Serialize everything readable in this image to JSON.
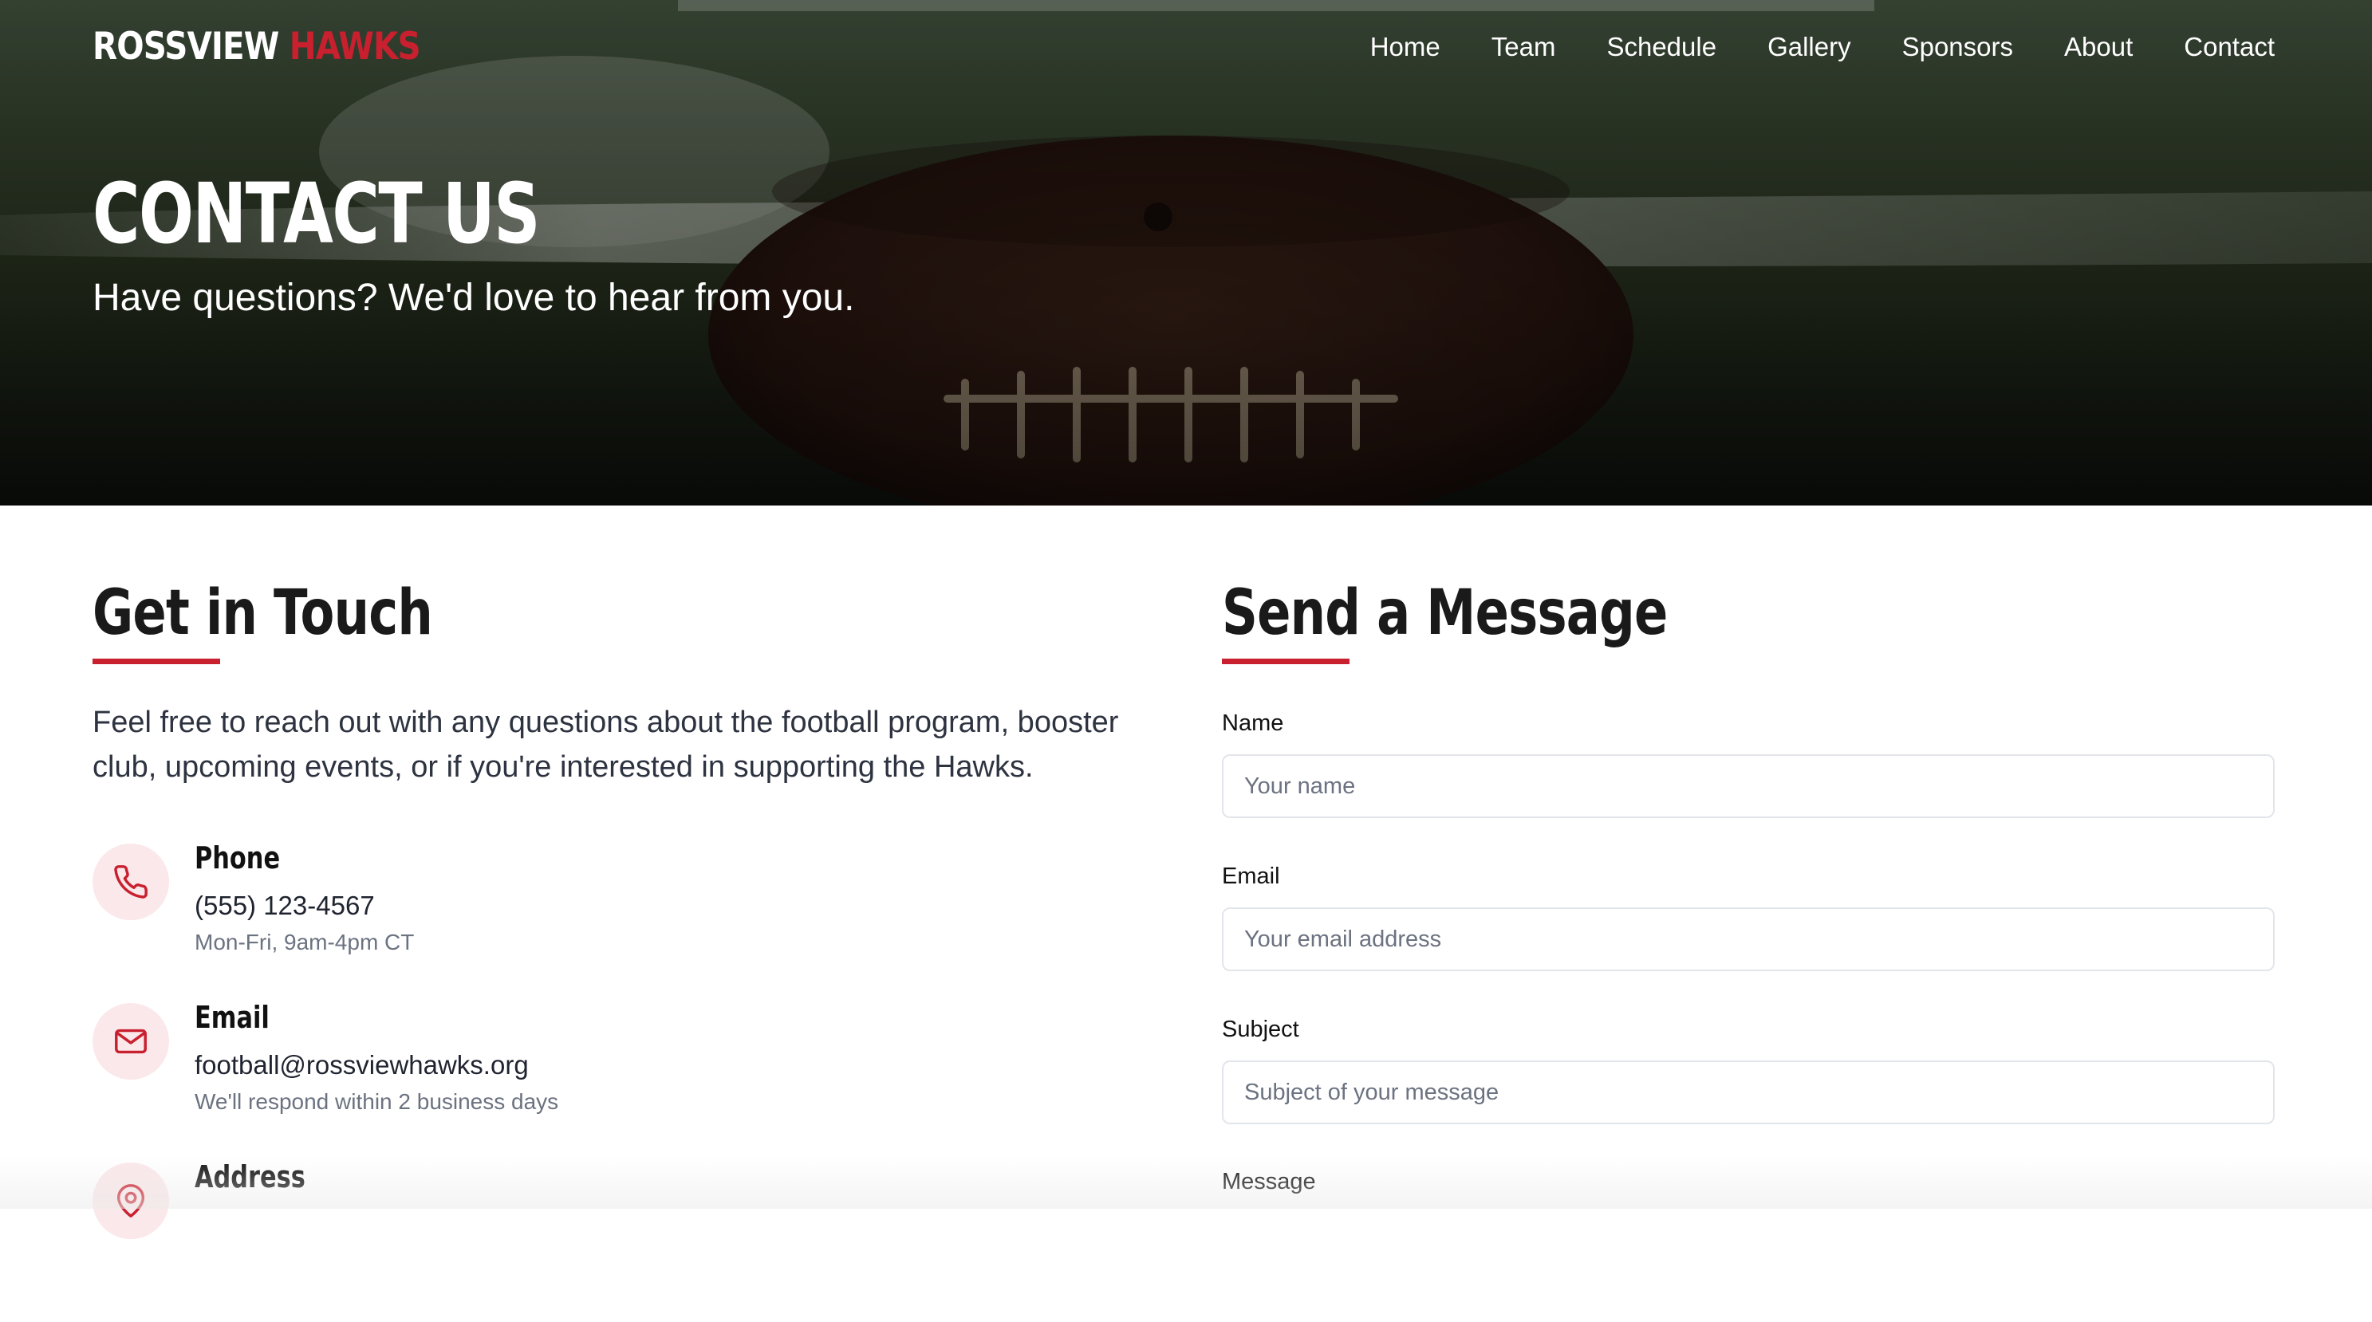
{
  "site": {
    "logo_main": "ROSSVIEW",
    "logo_accent": "HAWKS"
  },
  "nav": {
    "items": [
      {
        "label": "Home"
      },
      {
        "label": "Team"
      },
      {
        "label": "Schedule"
      },
      {
        "label": "Gallery"
      },
      {
        "label": "Sponsors"
      },
      {
        "label": "About"
      },
      {
        "label": "Contact"
      }
    ]
  },
  "hero": {
    "title": "CONTACT US",
    "subtitle": "Have questions? We'd love to hear from you."
  },
  "get_in_touch": {
    "title": "Get in Touch",
    "intro": "Feel free to reach out with any questions about the football program, booster club, upcoming events, or if you're interested in supporting the Hawks.",
    "items": [
      {
        "icon": "phone-icon",
        "title": "Phone",
        "value": "(555) 123-4567",
        "note": "Mon-Fri, 9am-4pm CT"
      },
      {
        "icon": "mail-icon",
        "title": "Email",
        "value": "football@rossviewhawks.org",
        "note": "We'll respond within 2 business days"
      },
      {
        "icon": "map-pin-icon",
        "title": "Address"
      }
    ]
  },
  "form": {
    "title": "Send a Message",
    "name_label": "Name",
    "name_placeholder": "Your name",
    "email_label": "Email",
    "email_placeholder": "Your email address",
    "subject_label": "Subject",
    "subject_placeholder": "Subject of your message",
    "message_label": "Message"
  },
  "colors": {
    "accent": "#c8202e",
    "icon_bg": "#fbe8ea",
    "heading": "#1a1a1a",
    "body_text": "#2d3340",
    "muted_text": "#6b7280",
    "input_border": "#e2e5ea"
  }
}
